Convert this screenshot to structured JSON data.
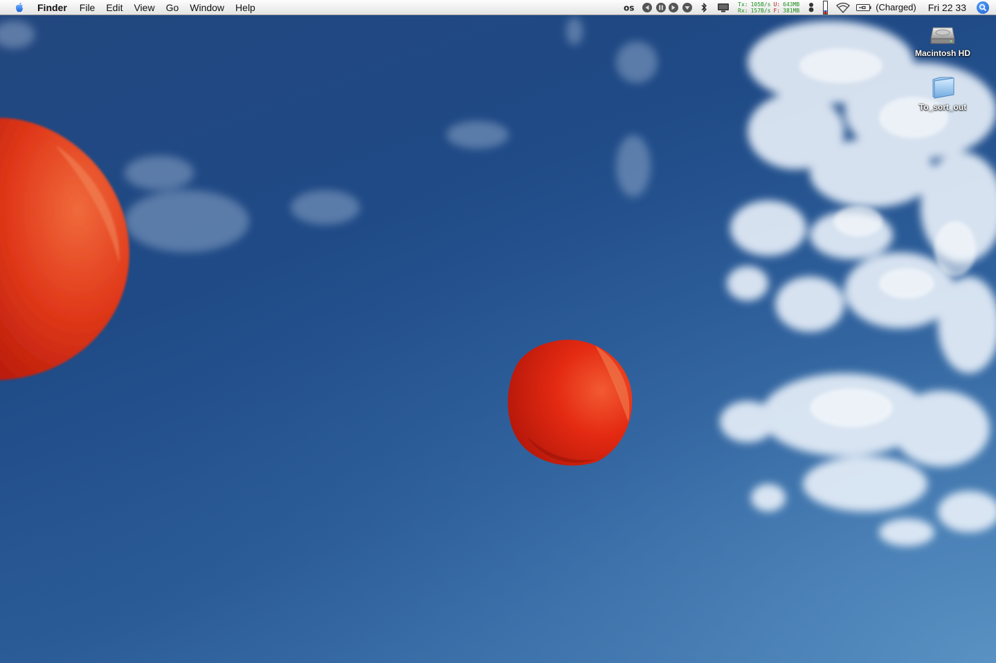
{
  "menubar": {
    "apple_icon": "apple-logo-icon",
    "app_name": "Finder",
    "menus": [
      "File",
      "Edit",
      "View",
      "Go",
      "Window",
      "Help"
    ]
  },
  "status": {
    "network": {
      "tx_label": "Tx:",
      "tx_rate": "105B/s",
      "rx_label": "Rx:",
      "rx_rate": "157B/s",
      "used_label": "U:",
      "used_mem": "643MB",
      "free_label": "F:",
      "free_mem": "381MB"
    },
    "battery_text": "(Charged)",
    "clock": "Fri 22 33"
  },
  "desktop_icons": [
    {
      "label": "Macintosh HD",
      "icon": "hard-drive-icon"
    },
    {
      "label": "To_sort_out",
      "icon": "folder-icon"
    }
  ],
  "colors": {
    "sky": "#214a85",
    "balloon": "#e02a12",
    "menubar": "#ececec",
    "spotlight": "#2a6fe0"
  }
}
